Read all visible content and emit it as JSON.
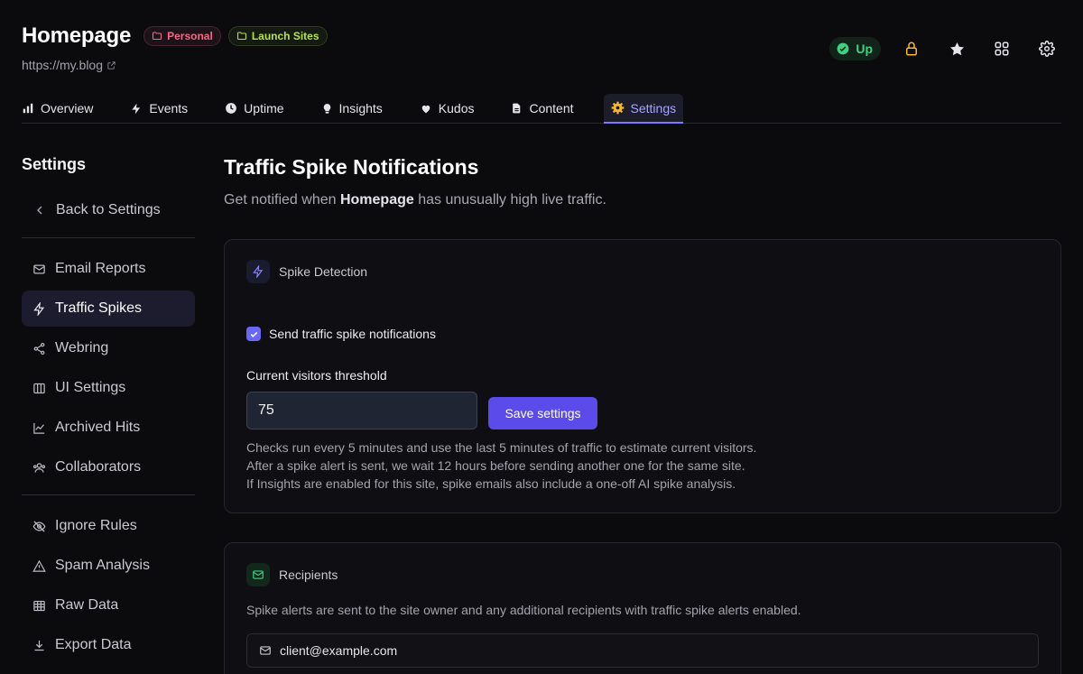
{
  "site": {
    "title": "Homepage",
    "url": "https://my.blog",
    "badges": [
      {
        "label": "Personal",
        "color": "#f26a86"
      },
      {
        "label": "Launch Sites",
        "color": "#b5e04a"
      }
    ],
    "status": "Up"
  },
  "tabs": [
    {
      "label": "Overview",
      "icon": "bar-chart-icon"
    },
    {
      "label": "Events",
      "icon": "lightning-icon"
    },
    {
      "label": "Uptime",
      "icon": "clock-icon"
    },
    {
      "label": "Insights",
      "icon": "lightbulb-icon"
    },
    {
      "label": "Kudos",
      "icon": "heart-icon"
    },
    {
      "label": "Content",
      "icon": "document-icon"
    },
    {
      "label": "Settings",
      "icon": "gear-icon",
      "active": true
    }
  ],
  "sidebar": {
    "title": "Settings",
    "back_label": "Back to Settings",
    "group1": [
      {
        "label": "Email Reports",
        "icon": "mail-icon"
      },
      {
        "label": "Traffic Spikes",
        "icon": "lightning-icon",
        "active": true
      },
      {
        "label": "Webring",
        "icon": "share-icon"
      },
      {
        "label": "UI Settings",
        "icon": "columns-icon"
      },
      {
        "label": "Archived Hits",
        "icon": "line-chart-icon"
      },
      {
        "label": "Collaborators",
        "icon": "users-icon"
      }
    ],
    "group2": [
      {
        "label": "Ignore Rules",
        "icon": "eye-off-icon"
      },
      {
        "label": "Spam Analysis",
        "icon": "warning-icon"
      },
      {
        "label": "Raw Data",
        "icon": "table-icon"
      },
      {
        "label": "Export Data",
        "icon": "download-icon"
      }
    ]
  },
  "main": {
    "title": "Traffic Spike Notifications",
    "subtitle_pre": "Get notified when ",
    "subtitle_site": "Homepage",
    "subtitle_post": " has unusually high live traffic.",
    "spike_card": {
      "heading": "Spike Detection",
      "checkbox_label": "Send traffic spike notifications",
      "checkbox_checked": true,
      "threshold_label": "Current visitors threshold",
      "threshold_value": "75",
      "save_label": "Save settings",
      "help_lines": [
        "Checks run every 5 minutes and use the last 5 minutes of traffic to estimate current visitors.",
        "After a spike alert is sent, we wait 12 hours before sending another one for the same site.",
        "If Insights are enabled for this site, spike emails also include a one-off AI spike analysis."
      ]
    },
    "recipients_card": {
      "heading": "Recipients",
      "description": "Spike alerts are sent to the site owner and any additional recipients with traffic spike alerts enabled.",
      "recipients": [
        "client@example.com"
      ]
    }
  },
  "colors": {
    "accent": "#5a4bea",
    "status_up": "#3fd17f",
    "lock": "#f5b82e"
  }
}
